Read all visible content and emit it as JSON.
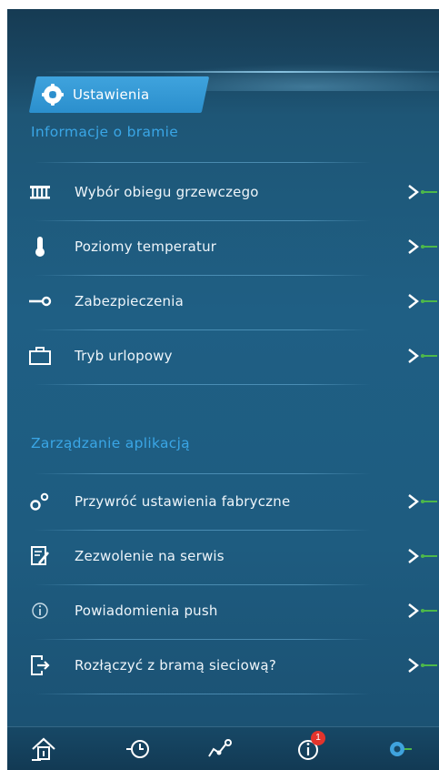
{
  "header": {
    "tab_label": "Ustawienia"
  },
  "sections": [
    {
      "title": "Informacje o bramie",
      "items": [
        {
          "label": "Wybór obiegu grzewczego",
          "icon": "heating-circuit-icon"
        },
        {
          "label": "Poziomy temperatur",
          "icon": "thermometer-icon"
        },
        {
          "label": "Zabezpieczenia",
          "icon": "key-icon"
        },
        {
          "label": "Tryb urlopowy",
          "icon": "suitcase-icon"
        }
      ]
    },
    {
      "title": "Zarządzanie aplikacją",
      "items": [
        {
          "label": "Przywróć ustawienia fabryczne",
          "icon": "factory-reset-icon"
        },
        {
          "label": "Zezwolenie na serwis",
          "icon": "service-permission-icon"
        },
        {
          "label": "Powiadomienia push",
          "icon": "info-icon"
        },
        {
          "label": "Rozłączyć z bramą sieciową?",
          "icon": "disconnect-icon"
        }
      ]
    }
  ],
  "bottom_nav": {
    "items": [
      {
        "name": "home",
        "icon": "home-icon"
      },
      {
        "name": "history",
        "icon": "history-icon"
      },
      {
        "name": "system",
        "icon": "system-graph-icon"
      },
      {
        "name": "info",
        "icon": "info-icon",
        "badge": "1"
      },
      {
        "name": "settings",
        "icon": "gear-icon",
        "active": true
      }
    ]
  },
  "colors": {
    "background": "#1f5f84",
    "accent": "#3aa6e6",
    "tab": "#2b8fcd",
    "arrow_green": "#4db84a",
    "badge": "#e2342c"
  }
}
